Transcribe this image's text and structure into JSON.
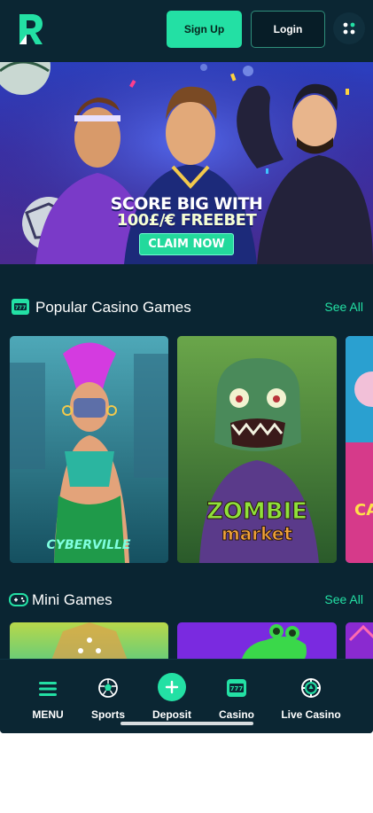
{
  "header": {
    "logo_letter": "R",
    "signup_label": "Sign Up",
    "login_label": "Login"
  },
  "banner": {
    "line1": "SCORE BIG WITH",
    "line2": "100£/€ FREEBET",
    "cta_label": "CLAIM NOW"
  },
  "popular": {
    "title": "Popular Casino Games",
    "see_all": "See All",
    "games": [
      {
        "logo": "CYBERVILLE"
      },
      {
        "logo_top": "ZOMBIE",
        "logo_bottom": "market"
      },
      {
        "logo": "CA"
      }
    ]
  },
  "mini": {
    "title": "Mini Games",
    "see_all": "See All"
  },
  "nav": {
    "items": [
      {
        "label": "MENU",
        "icon": "hamburger-icon"
      },
      {
        "label": "Sports",
        "icon": "soccer-ball-icon"
      },
      {
        "label": "Deposit",
        "icon": "plus-icon"
      },
      {
        "label": "Casino",
        "icon": "slot-machine-icon"
      },
      {
        "label": "Live Casino",
        "icon": "poker-chip-icon"
      }
    ]
  },
  "colors": {
    "accent": "#23e0a4",
    "background": "#0a2532",
    "header": "#0b2633"
  }
}
